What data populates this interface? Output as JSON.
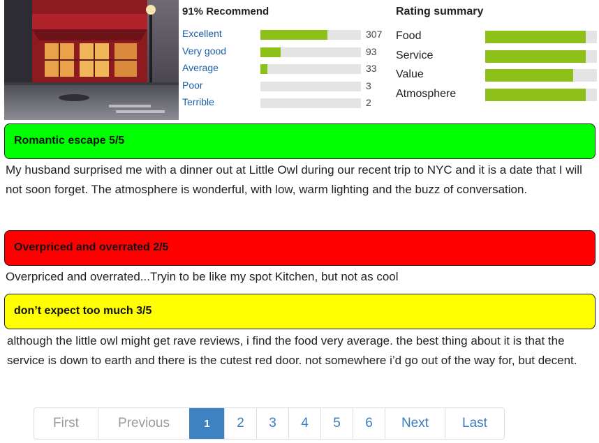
{
  "restaurant_photo": {
    "alt": "Little Owl restaurant exterior"
  },
  "recommend": {
    "title": "91% Recommend",
    "rows": [
      {
        "label": "Excellent",
        "count": "307",
        "fraction": 0.67
      },
      {
        "label": "Very good",
        "count": "93",
        "fraction": 0.2
      },
      {
        "label": "Average",
        "count": "33",
        "fraction": 0.07
      },
      {
        "label": "Poor",
        "count": "3",
        "fraction": 0.0
      },
      {
        "label": "Terrible",
        "count": "2",
        "fraction": 0.0
      }
    ]
  },
  "rating_summary": {
    "title": "Rating summary",
    "rows": [
      {
        "label": "Food",
        "fraction": 0.9
      },
      {
        "label": "Service",
        "fraction": 0.9
      },
      {
        "label": "Value",
        "fraction": 0.79
      },
      {
        "label": "Atmosphere",
        "fraction": 0.9
      }
    ]
  },
  "reviews": [
    {
      "title": "Romantic escape 5/5",
      "color": "#00ff00",
      "body": "My husband surprised me with a dinner out at Little Owl during our recent trip to NYC and it is a date that I will not soon forget. The atmosphere is wonderful, with low, warm lighting and the buzz of conversation."
    },
    {
      "title": "Overpriced and overrated 2/5",
      "color": "#ff0000",
      "body": "Overpriced and overrated...Tryin to be like my spot Kitchen, but not as cool"
    },
    {
      "title": "don’t expect too much 3/5",
      "color": "#ffff00",
      "body": "although the little owl might get rave reviews, i find the food very average. the best thing about it is that the service is down to earth and there is the cutest red door. not somewhere i’d go out of the way for, but decent."
    }
  ],
  "pagination": {
    "items": [
      {
        "label": "First",
        "state": "disabled"
      },
      {
        "label": "Previous",
        "state": "disabled"
      },
      {
        "label": "1",
        "state": "active"
      },
      {
        "label": "2",
        "state": "normal"
      },
      {
        "label": "3",
        "state": "normal"
      },
      {
        "label": "4",
        "state": "normal"
      },
      {
        "label": "5",
        "state": "normal"
      },
      {
        "label": "6",
        "state": "normal"
      },
      {
        "label": "Next",
        "state": "normal"
      },
      {
        "label": "Last",
        "state": "normal"
      }
    ]
  }
}
